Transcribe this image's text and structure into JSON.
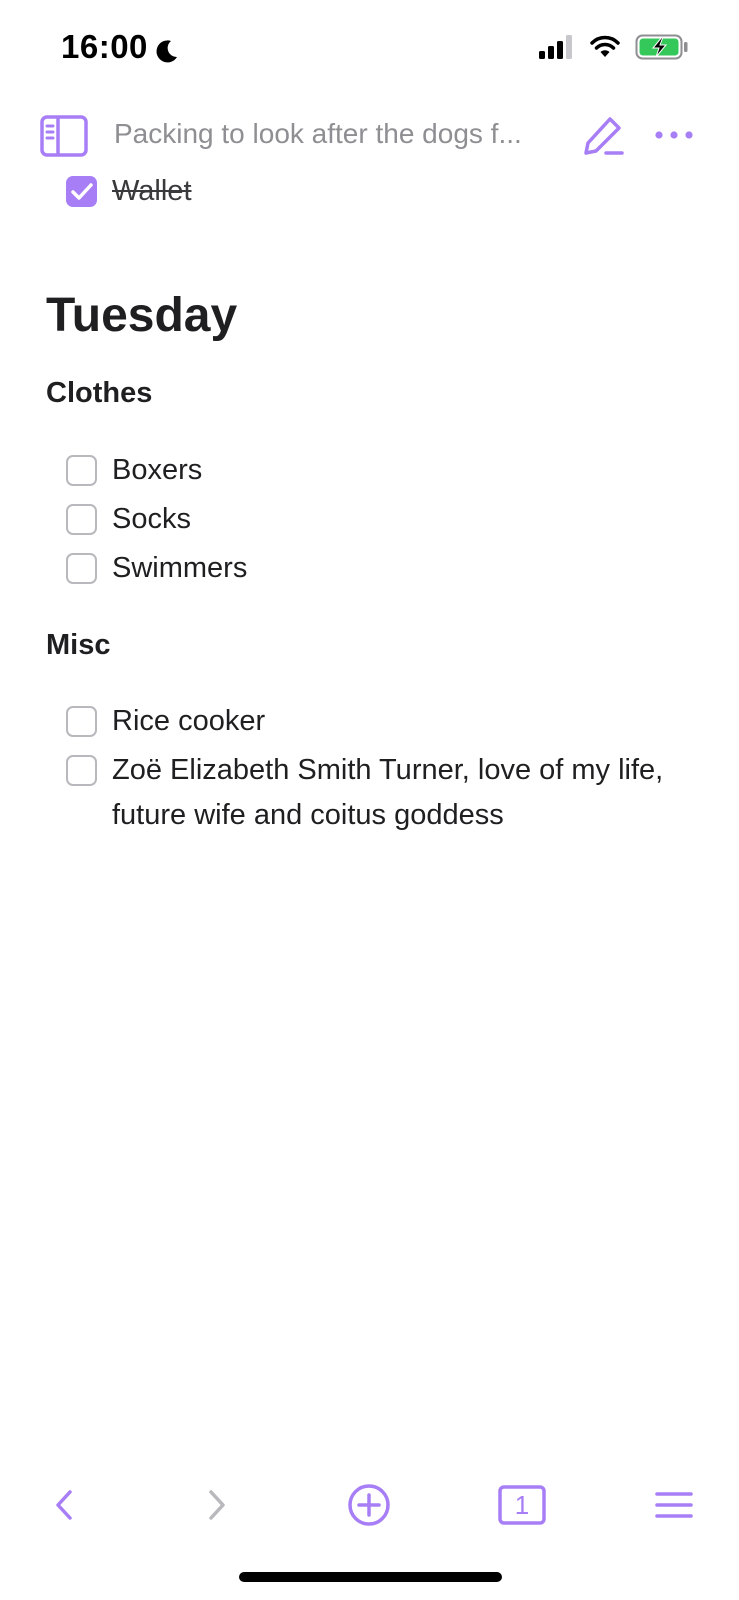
{
  "status_bar": {
    "time": "16:00",
    "icons": [
      "moon-icon",
      "signal-icon",
      "wifi-icon",
      "battery-charging-icon"
    ]
  },
  "toolbar": {
    "title": "Packing to look after the dogs f..."
  },
  "list": {
    "previous_item": {
      "label": "Wallet",
      "checked": true
    },
    "day_heading": "Tuesday",
    "sections": [
      {
        "title": "Clothes",
        "items": [
          {
            "label": "Boxers",
            "checked": false
          },
          {
            "label": "Socks",
            "checked": false
          },
          {
            "label": "Swimmers",
            "checked": false
          }
        ]
      },
      {
        "title": "Misc",
        "items": [
          {
            "label": "Rice cooker",
            "checked": false
          },
          {
            "label": "Zoë Elizabeth Smith Turner, love of my life, future wife and coitus goddess",
            "checked": false
          }
        ]
      }
    ]
  },
  "bottom_bar": {
    "tab_count": "1"
  },
  "colors": {
    "accent": "#a77ef5",
    "text": "#1f1f21",
    "muted": "#8e8e93",
    "disabled": "#b8b8bd"
  }
}
